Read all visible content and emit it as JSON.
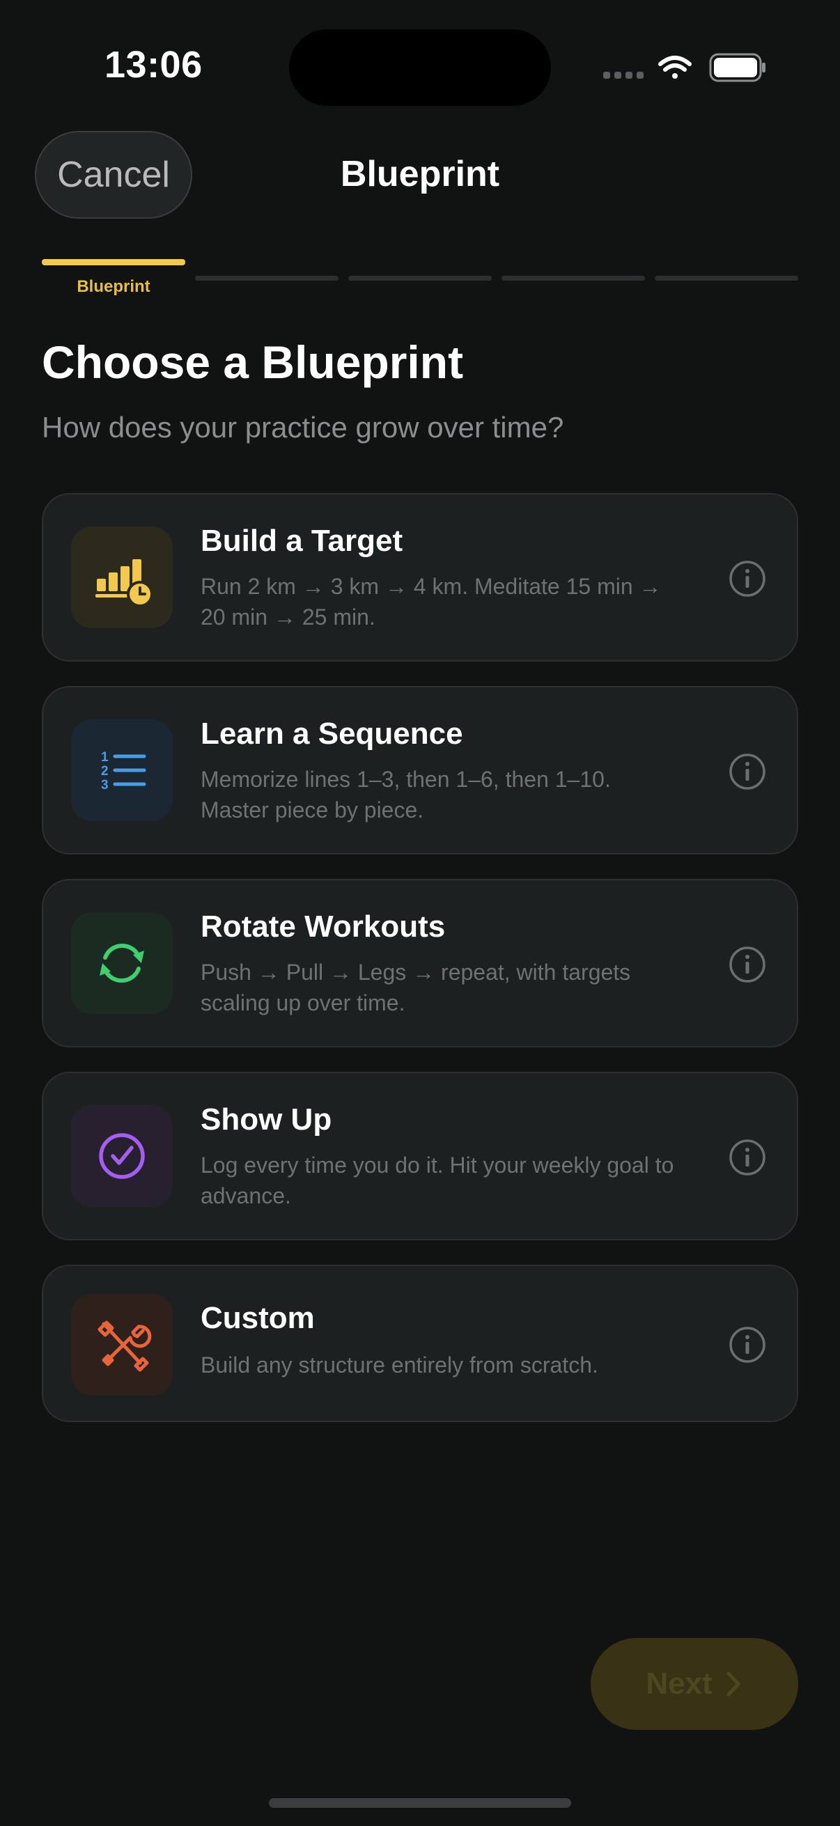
{
  "status_bar": {
    "time": "13:06"
  },
  "nav": {
    "cancel_label": "Cancel",
    "title": "Blueprint"
  },
  "progress": {
    "current_step_label": "Blueprint",
    "total_steps": 5,
    "current_step": 1
  },
  "main": {
    "heading": "Choose a Blueprint",
    "subheading": "How does your practice grow over time?"
  },
  "options": [
    {
      "title": "Build a Target",
      "description": "Run 2 km → 3 km → 4 km. Meditate 15 min → 20 min → 25 min.",
      "icon": "bar-chart-clock-icon",
      "color": "#f2c94c"
    },
    {
      "title": "Learn a Sequence",
      "description": "Memorize lines 1–3, then 1–6, then 1–10. Master piece by piece.",
      "icon": "numbered-list-icon",
      "color": "#4a9be8"
    },
    {
      "title": "Rotate Workouts",
      "description": "Push → Pull → Legs → repeat, with targets scaling up over time.",
      "icon": "rotate-arrows-icon",
      "color": "#3ecf6e"
    },
    {
      "title": "Show Up",
      "description": "Log every time you do it. Hit your weekly goal to advance.",
      "icon": "check-circle-icon",
      "color": "#a65ef0"
    },
    {
      "title": "Custom",
      "description": "Build any structure entirely from scratch.",
      "icon": "tools-icon",
      "color": "#e8643a"
    }
  ],
  "footer": {
    "next_label": "Next"
  }
}
